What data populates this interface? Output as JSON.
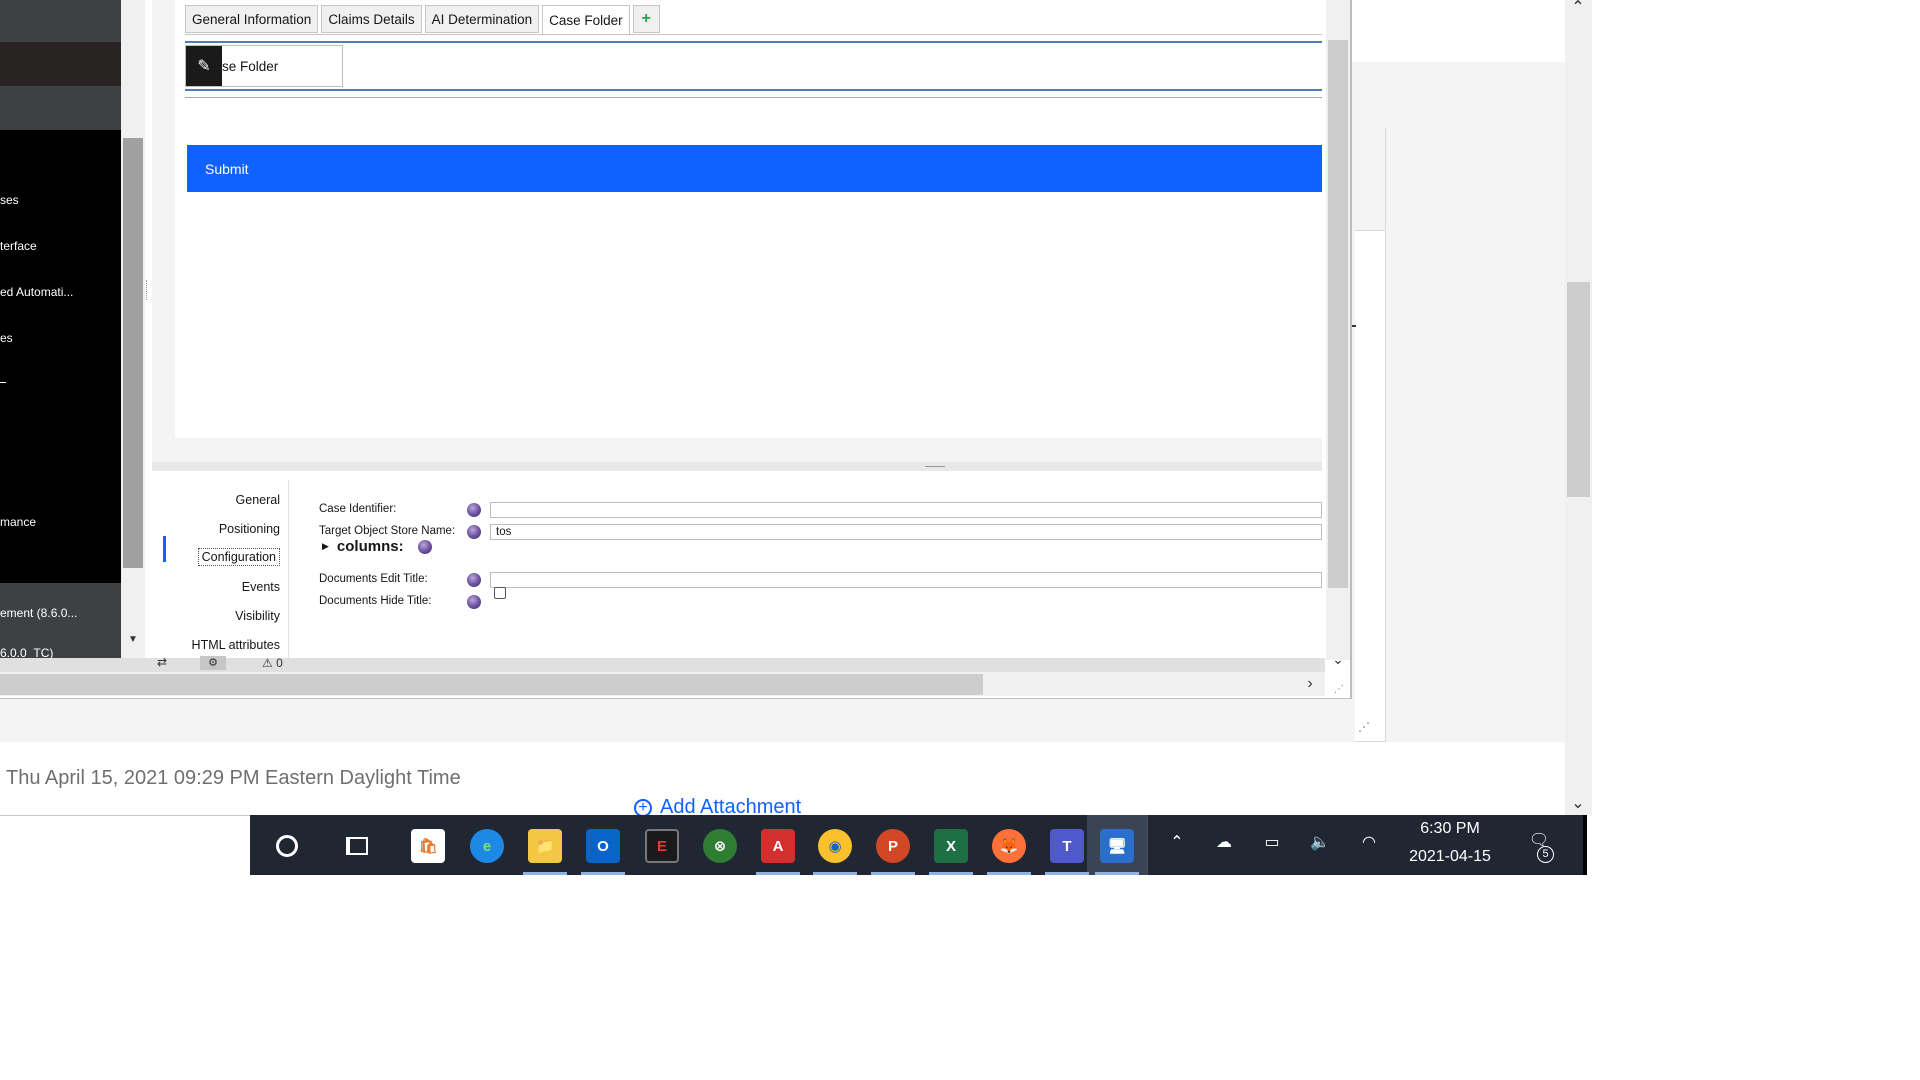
{
  "background": {
    "date_text": "Thu April 15, 2021 09:29 PM Eastern Daylight Time",
    "add_attachment_label": "Add Attachment"
  },
  "left_nav": {
    "items": [
      {
        "label": "ses"
      },
      {
        "label": "terface"
      },
      {
        "label": "ed Automati..."
      },
      {
        "label": "es"
      },
      {
        "label": "mance"
      },
      {
        "label": "ement (8.6.0..."
      },
      {
        "label": "6.0.0_TC)"
      }
    ]
  },
  "tabs": [
    {
      "label": "General Information"
    },
    {
      "label": "Claims Details"
    },
    {
      "label": "AI Determination"
    },
    {
      "label": "Case Folder"
    }
  ],
  "tab_add_label": "+",
  "canvas": {
    "case_folder_label": "se Folder",
    "submit_label": "Submit"
  },
  "properties": {
    "nav": [
      {
        "label": "General"
      },
      {
        "label": "Positioning"
      },
      {
        "label": "Configuration"
      },
      {
        "label": "Events"
      },
      {
        "label": "Visibility"
      },
      {
        "label": "HTML attributes"
      }
    ],
    "case_identifier_label": "Case Identifier:",
    "case_identifier_value": "",
    "target_object_store_label": "Target Object Store Name:",
    "target_object_store_value": "tos",
    "columns_label": "columns:",
    "documents_edit_title_label": "Documents Edit Title:",
    "documents_edit_title_value": "",
    "documents_hide_title_label": "Documents Hide Title:",
    "documents_hide_title_checked": false
  },
  "status_bar": {
    "warning_count": "0"
  },
  "taskbar": {
    "apps": [
      {
        "name": "microsoft-store",
        "glyph": "🛍"
      },
      {
        "name": "edge",
        "glyph": "e"
      },
      {
        "name": "file-explorer",
        "glyph": "📁"
      },
      {
        "name": "outlook",
        "glyph": "O"
      },
      {
        "name": "app-e",
        "glyph": "E"
      },
      {
        "name": "xbox",
        "glyph": "⊗"
      },
      {
        "name": "acrobat",
        "glyph": "A"
      },
      {
        "name": "chrome",
        "glyph": "◉"
      },
      {
        "name": "powerpoint",
        "glyph": "P"
      },
      {
        "name": "excel",
        "glyph": "X"
      },
      {
        "name": "firefox",
        "glyph": "🦊"
      },
      {
        "name": "teams",
        "glyph": "T"
      },
      {
        "name": "remote-desktop",
        "glyph": "🖥"
      }
    ],
    "time": "6:30 PM",
    "date": "2021-04-15",
    "notification_count": "5"
  },
  "colors": {
    "accent_blue": "#0f62fe",
    "taskbar_bg": "#202733",
    "nav_bg": "#000000"
  }
}
